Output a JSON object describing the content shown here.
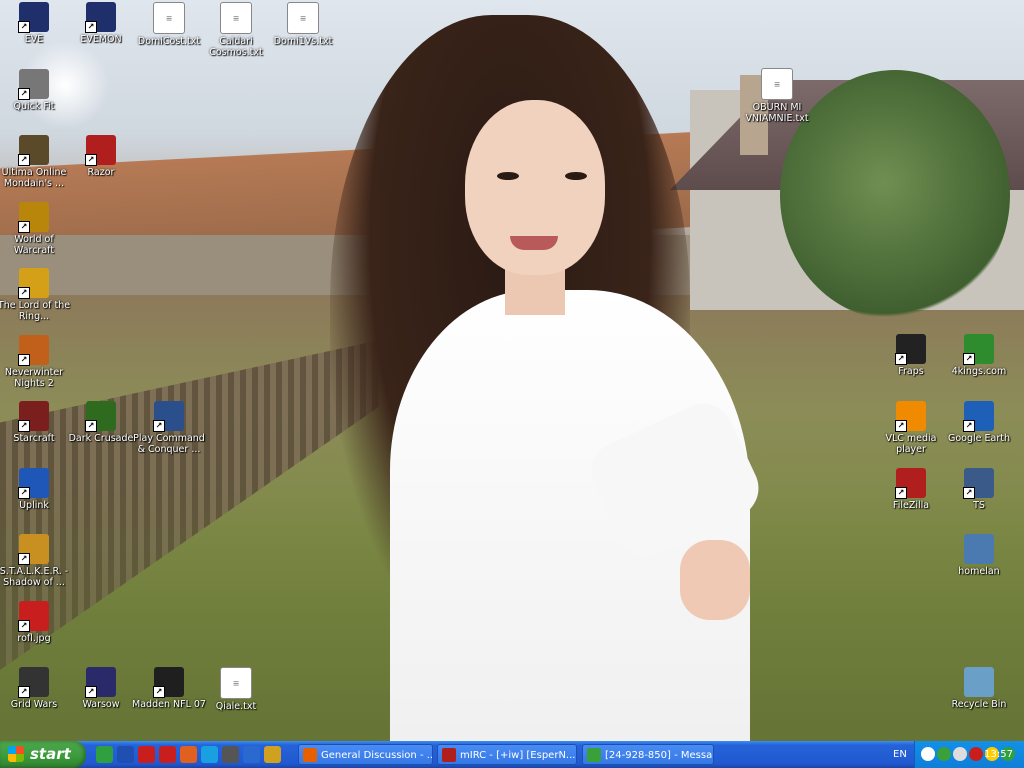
{
  "desktop": {
    "icons_left": [
      {
        "label": "EVE",
        "icon": "eve-icon",
        "color": "#1f2f6b"
      },
      {
        "label": "EVEMON",
        "icon": "evemon-icon",
        "color": "#1f2f6b"
      },
      {
        "label": "DomiCost.txt",
        "icon": "text-file-icon",
        "color": "#ffffff"
      },
      {
        "label": "Caldari Cosmos.txt",
        "icon": "text-file-icon",
        "color": "#ffffff"
      },
      {
        "label": "Domi1Vs.txt",
        "icon": "text-file-icon",
        "color": "#ffffff"
      },
      {
        "label": "Quick Fit",
        "icon": "quickfit-icon",
        "color": "#777777"
      },
      {
        "label": "Ultima Online Mondain's ...",
        "icon": "ultima-online-icon",
        "color": "#5a4a2a"
      },
      {
        "label": "Razor",
        "icon": "razor-icon",
        "color": "#b01e1e"
      },
      {
        "label": "World of Warcraft",
        "icon": "wow-icon",
        "color": "#b8860b"
      },
      {
        "label": "The Lord of the Ring...",
        "icon": "lotr-ring-icon",
        "color": "#d4a017"
      },
      {
        "label": "Neverwinter Nights 2",
        "icon": "nwn2-icon",
        "color": "#c0601a"
      },
      {
        "label": "Starcraft",
        "icon": "starcraft-icon",
        "color": "#7a1e1e"
      },
      {
        "label": "Dark Crusade",
        "icon": "dark-crusade-icon",
        "color": "#2f6b1f"
      },
      {
        "label": "Play Command & Conquer ...",
        "icon": "cnc-icon",
        "color": "#2a4f8a"
      },
      {
        "label": "Uplink",
        "icon": "uplink-icon",
        "color": "#1f57b8"
      },
      {
        "label": "S.T.A.L.K.E.R. - Shadow of ...",
        "icon": "stalker-icon",
        "color": "#c89020"
      },
      {
        "label": "rofl.jpg",
        "icon": "image-file-icon",
        "color": "#c81e1e"
      },
      {
        "label": "Grid Wars",
        "icon": "grid-wars-icon",
        "color": "#333333"
      },
      {
        "label": "Warsow",
        "icon": "warsow-icon",
        "color": "#2a2a6a"
      },
      {
        "label": "Madden NFL 07",
        "icon": "madden-icon",
        "color": "#1f1f1f"
      },
      {
        "label": "Qiale.txt",
        "icon": "text-file-icon",
        "color": "#ffffff"
      }
    ],
    "icons_right": [
      {
        "label": "OBURN MI VNIAMNIE.txt",
        "icon": "text-file-icon",
        "color": "#ffffff"
      },
      {
        "label": "Fraps",
        "icon": "fraps-icon",
        "color": "#222222"
      },
      {
        "label": "4kings.com",
        "icon": "4kings-icon",
        "color": "#2e8b2e"
      },
      {
        "label": "VLC media player",
        "icon": "vlc-cone-icon",
        "color": "#f08a00"
      },
      {
        "label": "Google Earth",
        "icon": "google-earth-icon",
        "color": "#1e5fb8"
      },
      {
        "label": "FileZilla",
        "icon": "filezilla-icon",
        "color": "#b01e1e"
      },
      {
        "label": "TS",
        "icon": "teamspeak-icon",
        "color": "#3a5a8a"
      },
      {
        "label": "homelan",
        "icon": "network-icon",
        "color": "#4a7ab0"
      },
      {
        "label": "Recycle Bin",
        "icon": "recycle-bin-icon",
        "color": "#6aa0c8"
      }
    ],
    "shortcut_arrow": "↗"
  },
  "taskbar": {
    "start_label": "start",
    "quick_launch": [
      {
        "icon": "msn-icon",
        "color": "#2f9f3f"
      },
      {
        "icon": "app-icon",
        "color": "#1f4fb0"
      },
      {
        "icon": "flag-icon",
        "color": "#c81e1e"
      },
      {
        "icon": "opera-icon",
        "color": "#c81e1e"
      },
      {
        "icon": "chat-icon",
        "color": "#e06020"
      },
      {
        "icon": "skype-icon",
        "color": "#1aa0e0"
      },
      {
        "icon": "media-icon",
        "color": "#555555"
      },
      {
        "icon": "tool-icon",
        "color": "#2a6ad0"
      },
      {
        "icon": "game-icon",
        "color": "#d0a020"
      }
    ],
    "tasks": [
      {
        "label": "General Discussion - ...",
        "icon": "firefox-icon",
        "color": "#e66000"
      },
      {
        "label": "mIRC - [+iw] [EsperN...",
        "icon": "mirc-icon",
        "color": "#b01e1e"
      },
      {
        "label": "[24-928-850] - Messa...",
        "icon": "messenger-icon",
        "color": "#3aa03a"
      }
    ],
    "language": "EN",
    "tray_icons": [
      {
        "icon": "arrow-left-icon",
        "color": "#ffffff"
      },
      {
        "icon": "msn-tray-icon",
        "color": "#3aa03a"
      },
      {
        "icon": "volume-icon",
        "color": "#dddddd"
      },
      {
        "icon": "antivirus-icon",
        "color": "#c81e1e"
      },
      {
        "icon": "security-icon",
        "color": "#ffcc00"
      },
      {
        "icon": "icq-icon",
        "color": "#2f9f3f"
      }
    ],
    "clock": "13:57"
  },
  "colors": {
    "taskbar": "#2158d0",
    "start": "#3a9a3a",
    "tray": "#0f7ed8"
  }
}
